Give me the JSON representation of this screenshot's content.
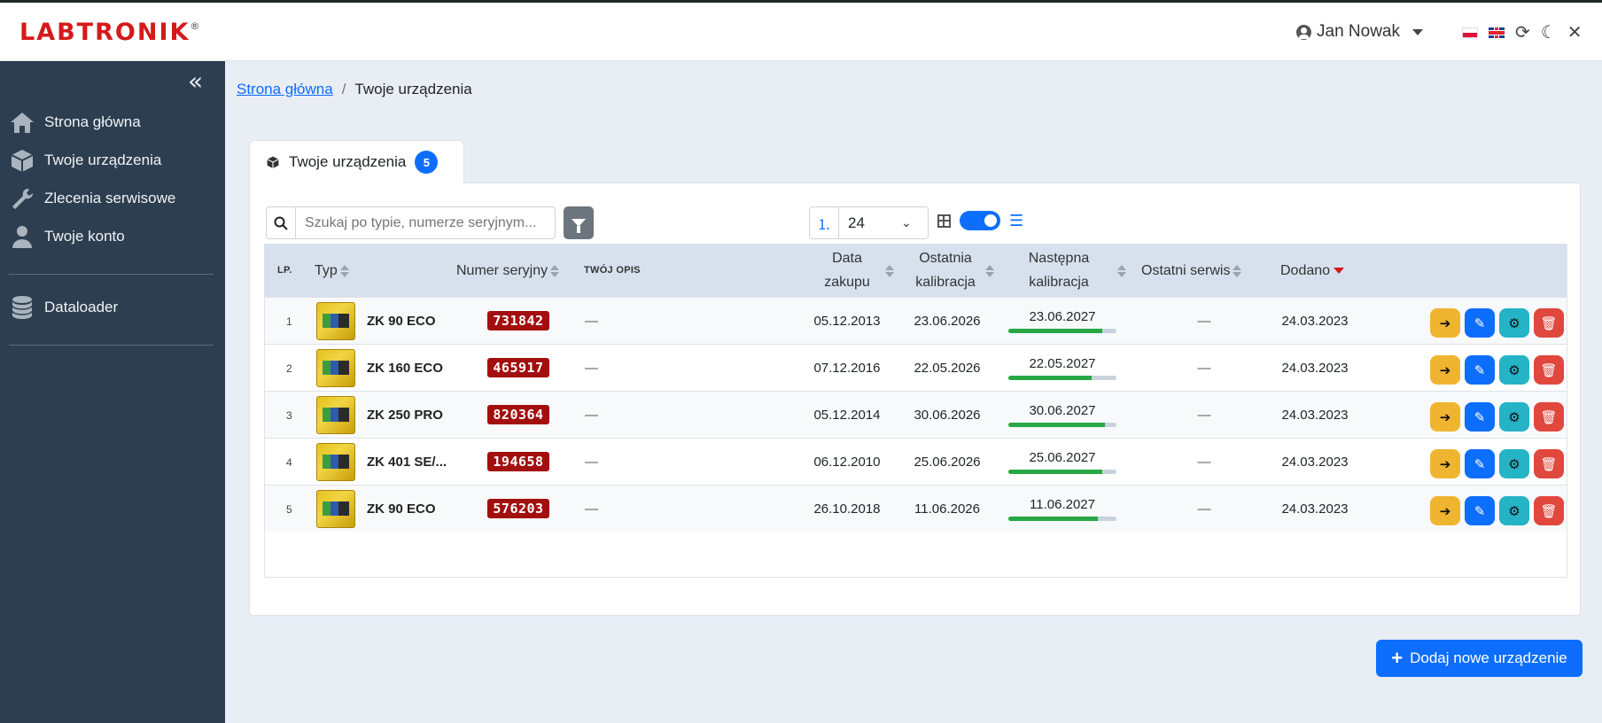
{
  "header": {
    "logo_text": "LABTRONIK",
    "logo_mark": "®",
    "user_name": "Jan Nowak",
    "icons": [
      "user-circle-icon",
      "flag-pl-icon",
      "flag-gb-icon",
      "refresh-icon",
      "moon-icon",
      "close-icon"
    ]
  },
  "sidebar": {
    "collapse_glyph": "«",
    "items": [
      {
        "label": "Strona główna",
        "icon": "home-icon"
      },
      {
        "label": "Twoje urządzenia",
        "icon": "box-icon"
      },
      {
        "label": "Zlecenia serwisowe",
        "icon": "wrench-icon"
      },
      {
        "label": "Twoje konto",
        "icon": "user-icon"
      },
      {
        "label": "Dataloader",
        "icon": "database-icon"
      }
    ]
  },
  "breadcrumb": {
    "home": "Strona główna",
    "separator": "/",
    "current": "Twoje urządzenia"
  },
  "tab": {
    "label": "Twoje urządzenia",
    "count": "5"
  },
  "toolbar": {
    "search_placeholder": "Szukaj po typie, numerze seryjnym...",
    "per_page": "24"
  },
  "table": {
    "headers": {
      "lp": "LP.",
      "type": "Typ",
      "serial": "Numer seryjny",
      "desc": "TWÓJ OPIS",
      "purchase_l1": "Data",
      "purchase_l2": "zakupu",
      "lastcal_l1": "Ostatnia",
      "lastcal_l2": "kalibracja",
      "nextcal_l1": "Następna",
      "nextcal_l2": "kalibracja",
      "lastservice": "Ostatni serwis",
      "added": "Dodano"
    },
    "rows": [
      {
        "lp": "1",
        "type": "ZK 90 ECO",
        "serial": "731842",
        "desc": "—",
        "purchase": "05.12.2013",
        "last_cal": "23.06.2026",
        "next_cal": "23.06.2027",
        "progress": 0.87,
        "last_service": "—",
        "added": "24.03.2023"
      },
      {
        "lp": "2",
        "type": "ZK 160 ECO",
        "serial": "465917",
        "desc": "—",
        "purchase": "07.12.2016",
        "last_cal": "22.05.2026",
        "next_cal": "22.05.2027",
        "progress": 0.77,
        "last_service": "—",
        "added": "24.03.2023"
      },
      {
        "lp": "3",
        "type": "ZK 250 PRO",
        "serial": "820364",
        "desc": "—",
        "purchase": "05.12.2014",
        "last_cal": "30.06.2026",
        "next_cal": "30.06.2027",
        "progress": 0.89,
        "last_service": "—",
        "added": "24.03.2023"
      },
      {
        "lp": "4",
        "type": "ZK 401 SE/...",
        "serial": "194658",
        "desc": "—",
        "purchase": "06.12.2010",
        "last_cal": "25.06.2026",
        "next_cal": "25.06.2027",
        "progress": 0.87,
        "last_service": "—",
        "added": "24.03.2023"
      },
      {
        "lp": "5",
        "type": "ZK 90 ECO",
        "serial": "576203",
        "desc": "—",
        "purchase": "26.10.2018",
        "last_cal": "11.06.2026",
        "next_cal": "11.06.2027",
        "progress": 0.83,
        "last_service": "—",
        "added": "24.03.2023"
      }
    ]
  },
  "add_button": {
    "label": "Dodaj nowe urządzenie"
  },
  "colors": {
    "primary": "#0d6efd",
    "sidebar": "#2c3e50",
    "serial_badge": "#a30f0f",
    "progress": "#28a745"
  }
}
